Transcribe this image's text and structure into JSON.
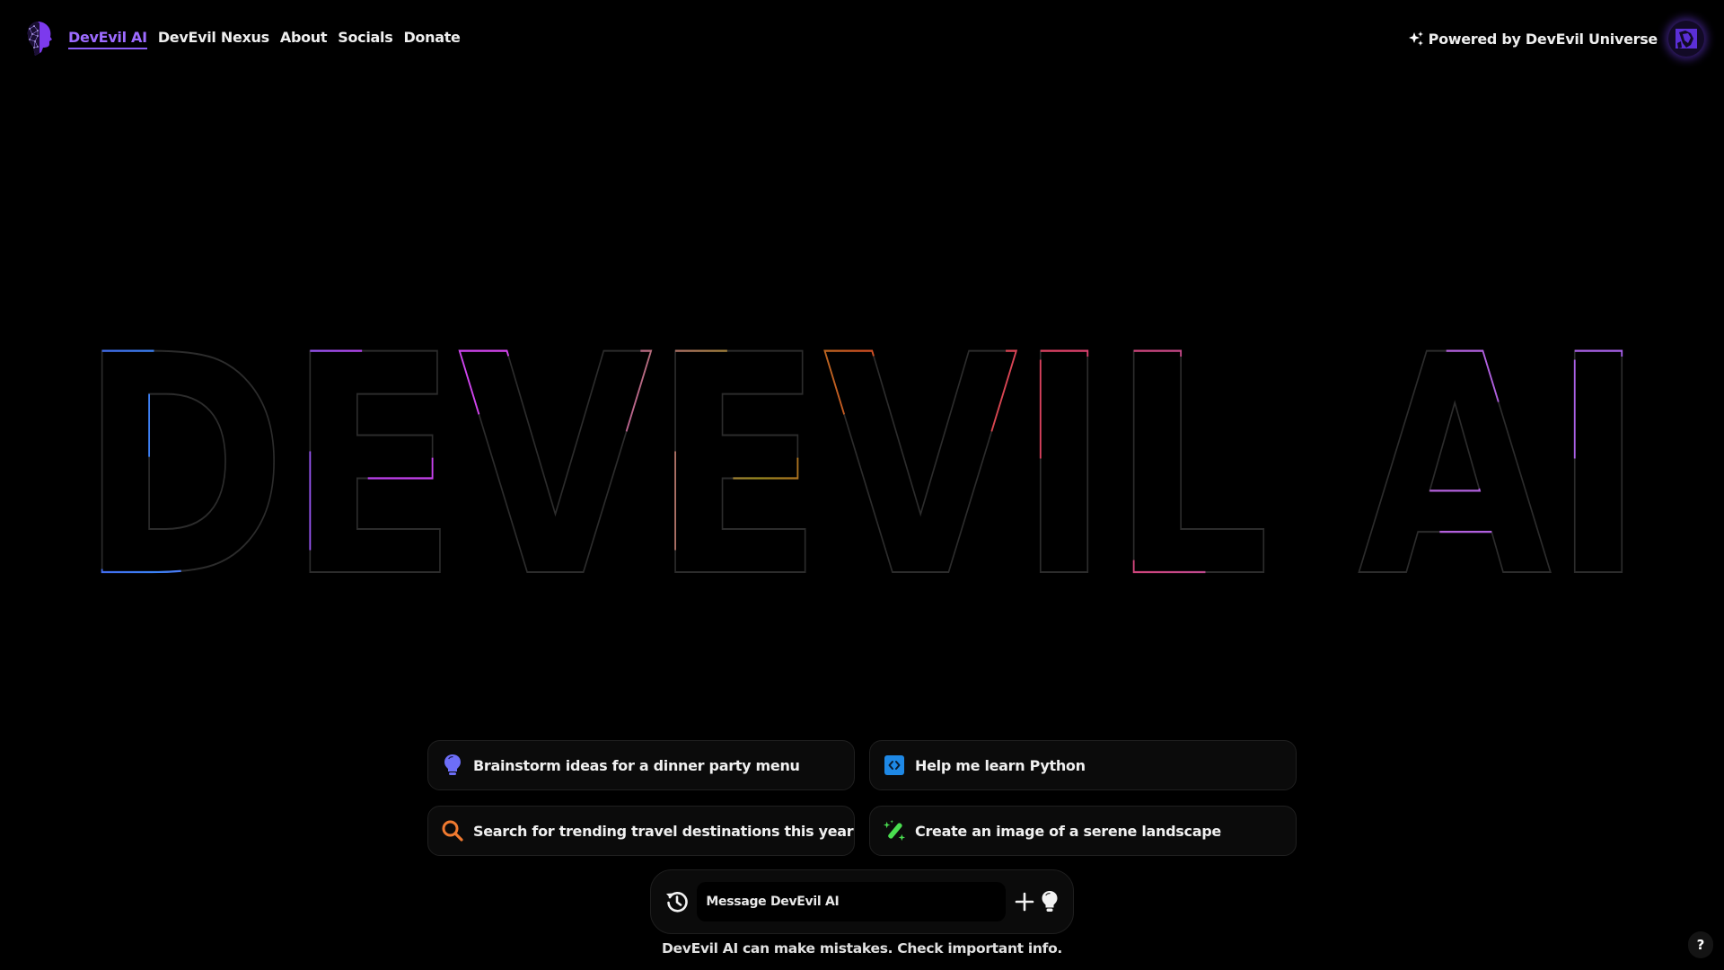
{
  "header": {
    "logo_alt": "DevEvil AI logo",
    "nav": [
      {
        "label": "DevEvil AI",
        "active": true
      },
      {
        "label": "DevEvil Nexus",
        "active": false
      },
      {
        "label": "About",
        "active": false
      },
      {
        "label": "Socials",
        "active": false
      },
      {
        "label": "Donate",
        "active": false
      }
    ],
    "powered_by": "Powered by DevEvil Universe",
    "powered_icon": "sparkle-icon",
    "avatar_icon": "universe-avatar"
  },
  "hero": {
    "title": "DEVEVIL AI",
    "outline_color": "#2a2a2a",
    "accent_colors": [
      "#4f46e5",
      "#3b82f6",
      "#a855f7",
      "#d946ef",
      "#65a30d",
      "#c2410c",
      "#e11d48",
      "#db2777",
      "#c084fc"
    ]
  },
  "suggestions": [
    {
      "label": "Brainstorm ideas for a dinner party menu",
      "icon": "lightbulb-icon",
      "color": "#6d6ef7"
    },
    {
      "label": "Help me learn Python",
      "icon": "code-icon",
      "color": "#1e88e5"
    },
    {
      "label": "Search for trending travel destinations this year",
      "icon": "search-icon",
      "color": "#f07a30"
    },
    {
      "label": "Create an image of a serene landscape",
      "icon": "magic-wand-icon",
      "color": "#4ade50"
    }
  ],
  "composer": {
    "placeholder": "Message DevEvil AI",
    "value": "",
    "history_icon": "history-icon",
    "add_icon": "plus-icon",
    "ideas_icon": "lightbulb-icon"
  },
  "disclaimer": "DevEvil AI can make mistakes. Check important info.",
  "help": {
    "label": "?"
  }
}
